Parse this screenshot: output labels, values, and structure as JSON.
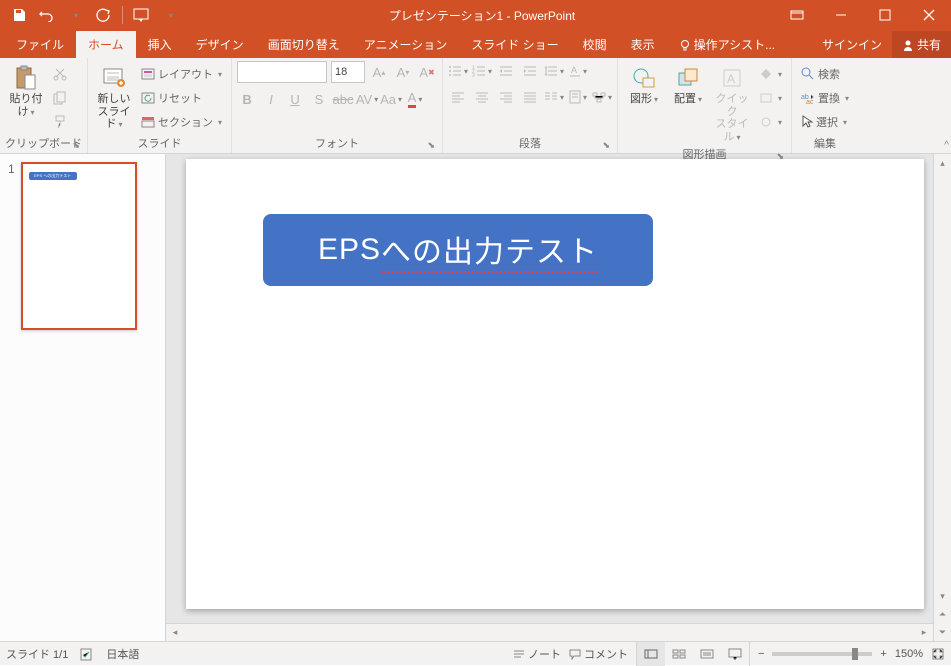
{
  "titlebar": {
    "title": "プレゼンテーション1 - PowerPoint"
  },
  "tabs": {
    "file": "ファイル",
    "home": "ホーム",
    "insert": "挿入",
    "design": "デザイン",
    "transitions": "画面切り替え",
    "animations": "アニメーション",
    "slideshow": "スライド ショー",
    "review": "校閲",
    "view": "表示",
    "tellme": "操作アシスト...",
    "signin": "サインイン",
    "share": "共有"
  },
  "ribbon": {
    "clipboard": {
      "paste": "貼り付け",
      "label": "クリップボード"
    },
    "slides": {
      "newslide": "新しい\nスライド",
      "layout": "レイアウト",
      "reset": "リセット",
      "section": "セクション",
      "label": "スライド"
    },
    "font": {
      "size": "18",
      "label": "フォント"
    },
    "paragraph": {
      "label": "段落"
    },
    "drawing": {
      "shapes": "図形",
      "arrange": "配置",
      "quick": "クイック\nスタイル",
      "label": "図形描画"
    },
    "editing": {
      "find": "検索",
      "replace": "置換",
      "select": "選択",
      "label": "編集"
    }
  },
  "thumbnail": {
    "num": "1",
    "shape_text": "EPS への出力テスト"
  },
  "slide": {
    "text_pre": "EPS ",
    "text_mid": "への出力テスト"
  },
  "statusbar": {
    "slide": "スライド 1/1",
    "lang": "日本語",
    "notes": "ノート",
    "comments": "コメント",
    "zoom": "150%"
  }
}
